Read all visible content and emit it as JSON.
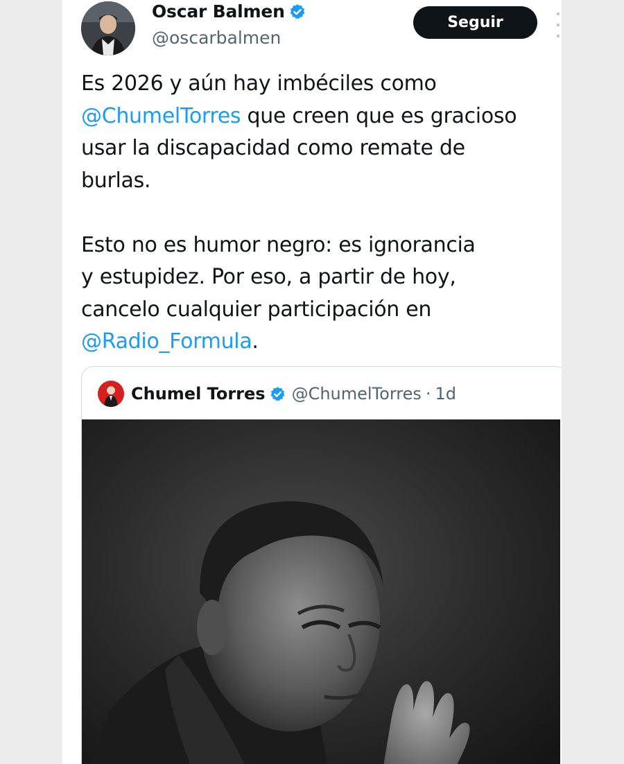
{
  "author": {
    "name": "Oscar Balmen",
    "handle": "@oscarbalmen",
    "follow_label": "Seguir",
    "verified_color": "#1d9bf0"
  },
  "tweet": {
    "lines": [
      [
        {
          "text": "Es 2026 y aún hay imbéciles como"
        }
      ],
      [
        {
          "text": "@ChumelTorres",
          "mention": true
        },
        {
          "text": " que creen que es gracioso"
        }
      ],
      [
        {
          "text": "usar la discapacidad como remate de"
        }
      ],
      [
        {
          "text": "burlas."
        }
      ],
      [],
      [
        {
          "text": "Esto no es humor negro: es ignorancia"
        }
      ],
      [
        {
          "text": "y estupidez. Por eso, a partir de hoy,"
        }
      ],
      [
        {
          "text": "cancelo cualquier participación en"
        }
      ],
      [
        {
          "text": "@Radio_Formula",
          "mention": true
        },
        {
          "text": "."
        }
      ]
    ]
  },
  "quote": {
    "name": "Chumel Torres",
    "handle": "@ChumelTorres",
    "separator": "·",
    "time": "1d",
    "media_description_icon": "photo-icon"
  },
  "colors": {
    "text": "#0f1419",
    "secondary": "#536471",
    "link": "#1d9bf0",
    "button": "#0f1419"
  }
}
